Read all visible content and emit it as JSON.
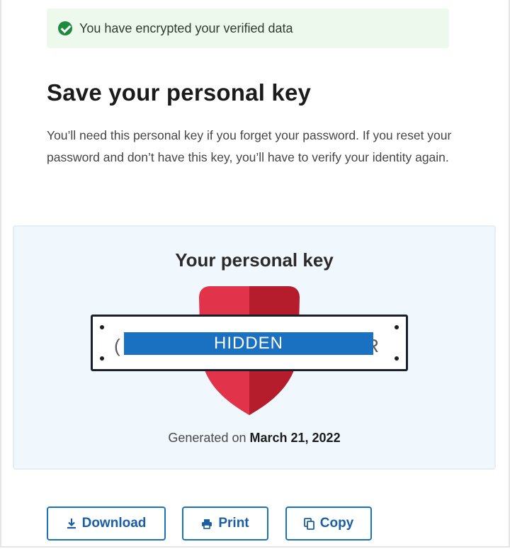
{
  "alert": {
    "icon": "check-circle-icon",
    "text": "You have encrypted your verified data",
    "color": "#1e8a3e"
  },
  "heading": "Save your personal key",
  "intro": "You’ll need this personal key if you forget your password. If you reset your password and don’t have this key, you’ll have to verify your identity again.",
  "key_panel": {
    "title": "Your personal key",
    "key_left_edge": "(",
    "key_masked": "HIDDEN",
    "key_right_edge": "R",
    "generated_prefix": "Generated on",
    "generated_date": "March 21, 2022",
    "shield_colors": [
      "#e1334a",
      "#b51d2d"
    ]
  },
  "actions": {
    "download_label": "Download",
    "download_icon": "download-icon",
    "print_label": "Print",
    "print_icon": "printer-icon",
    "copy_label": "Copy",
    "copy_icon": "copy-icon",
    "accent": "#1a70c1"
  }
}
